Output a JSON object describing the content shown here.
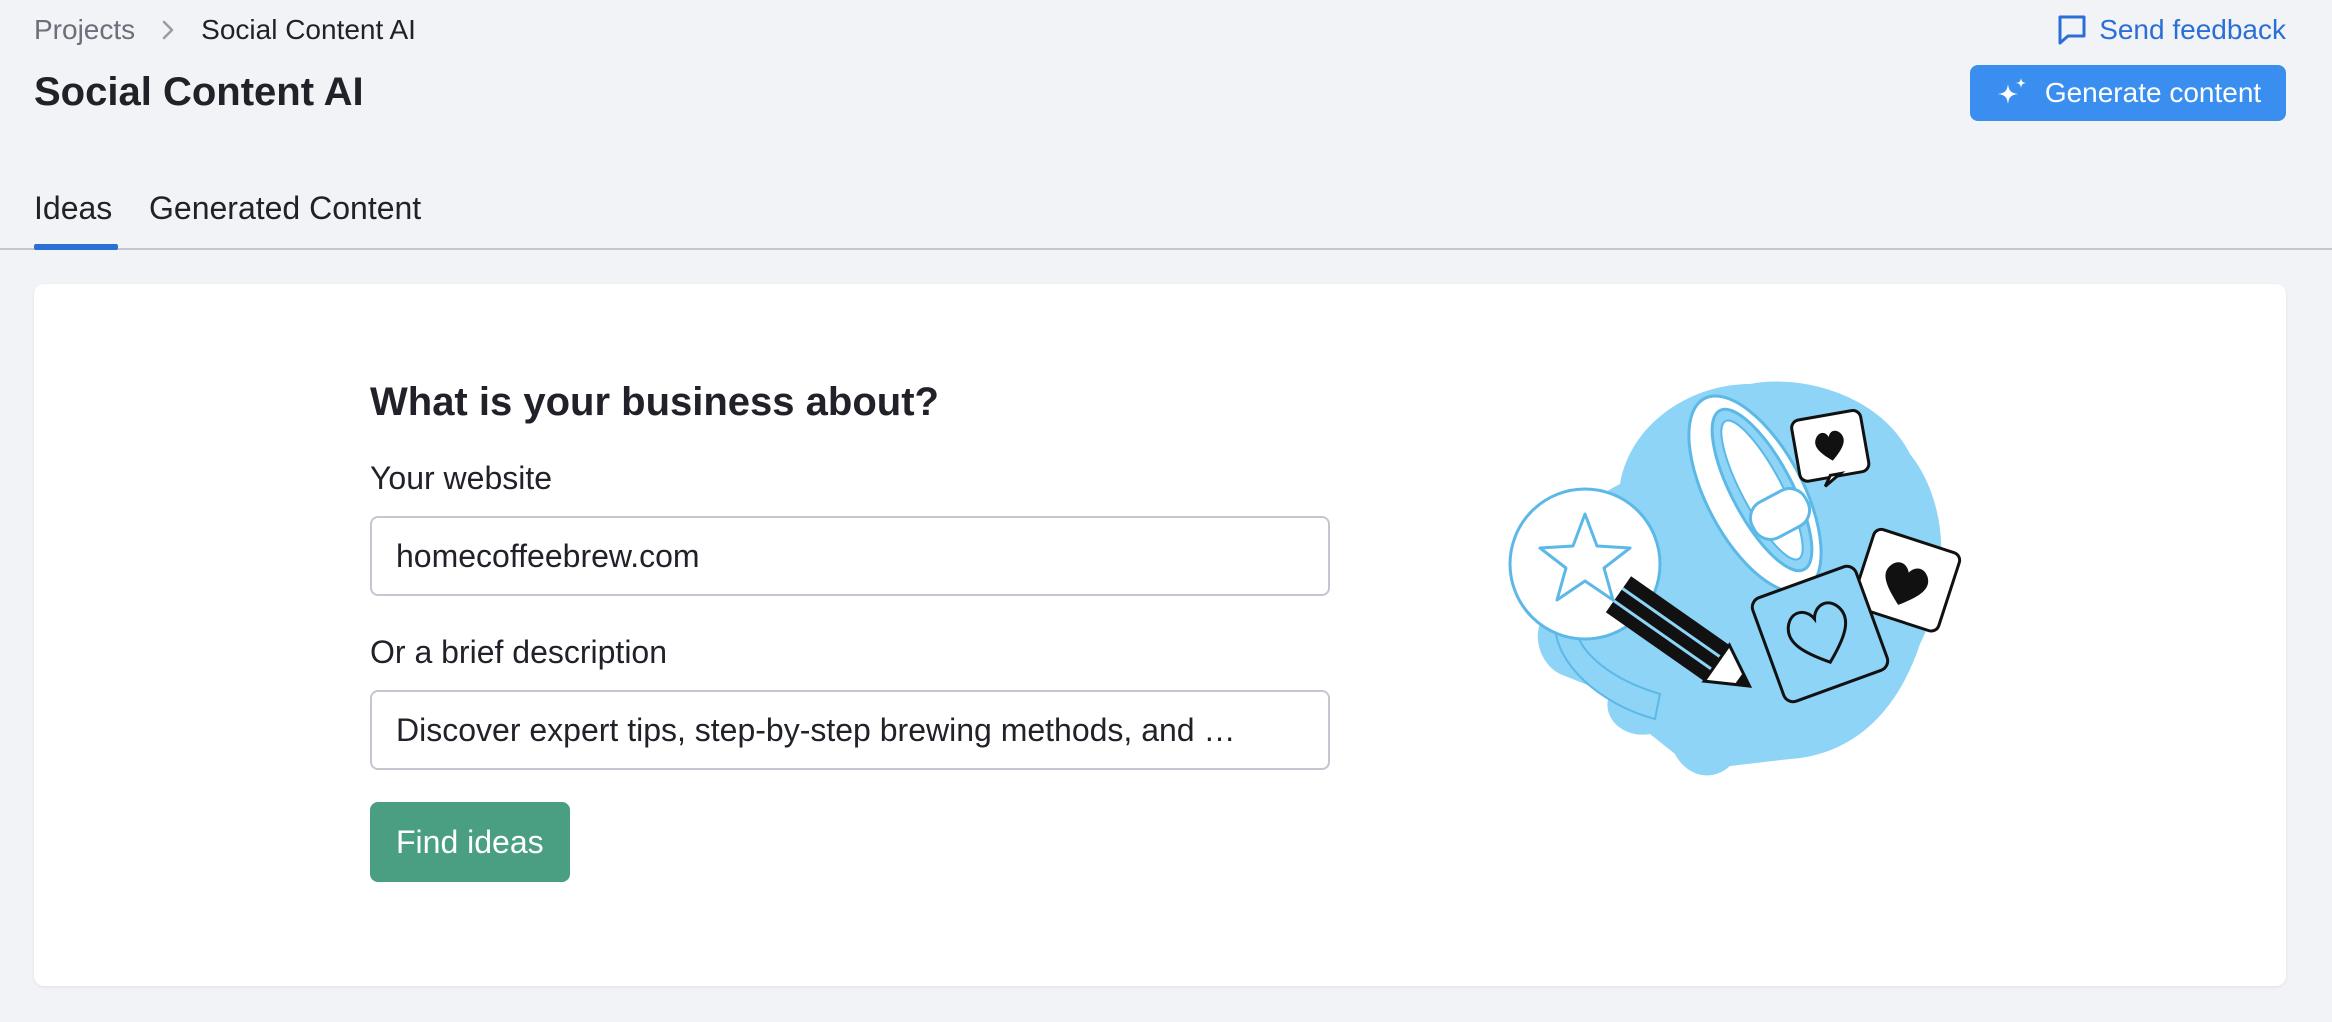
{
  "breadcrumb": {
    "parent": "Projects",
    "current": "Social Content AI"
  },
  "header": {
    "title": "Social Content AI",
    "feedback_label": "Send feedback",
    "generate_label": "Generate content"
  },
  "tabs": [
    {
      "label": "Ideas",
      "active": true
    },
    {
      "label": "Generated Content",
      "active": false
    }
  ],
  "form": {
    "heading": "What is your business about?",
    "website_label": "Your website",
    "website_value": "homecoffeebrew.com",
    "description_label": "Or a brief description",
    "description_value": "Discover expert tips, step-by-step brewing methods, and …",
    "find_label": "Find ideas"
  },
  "icons": {
    "breadcrumb_separator": "chevron-right-icon",
    "feedback": "chat-bubble-icon",
    "generate": "sparkle-icon"
  },
  "colors": {
    "accent_blue": "#3a8ef0",
    "link_blue": "#2b6fd6",
    "find_green": "#4a9e82",
    "illustration_blue": "#8dd4f6"
  }
}
